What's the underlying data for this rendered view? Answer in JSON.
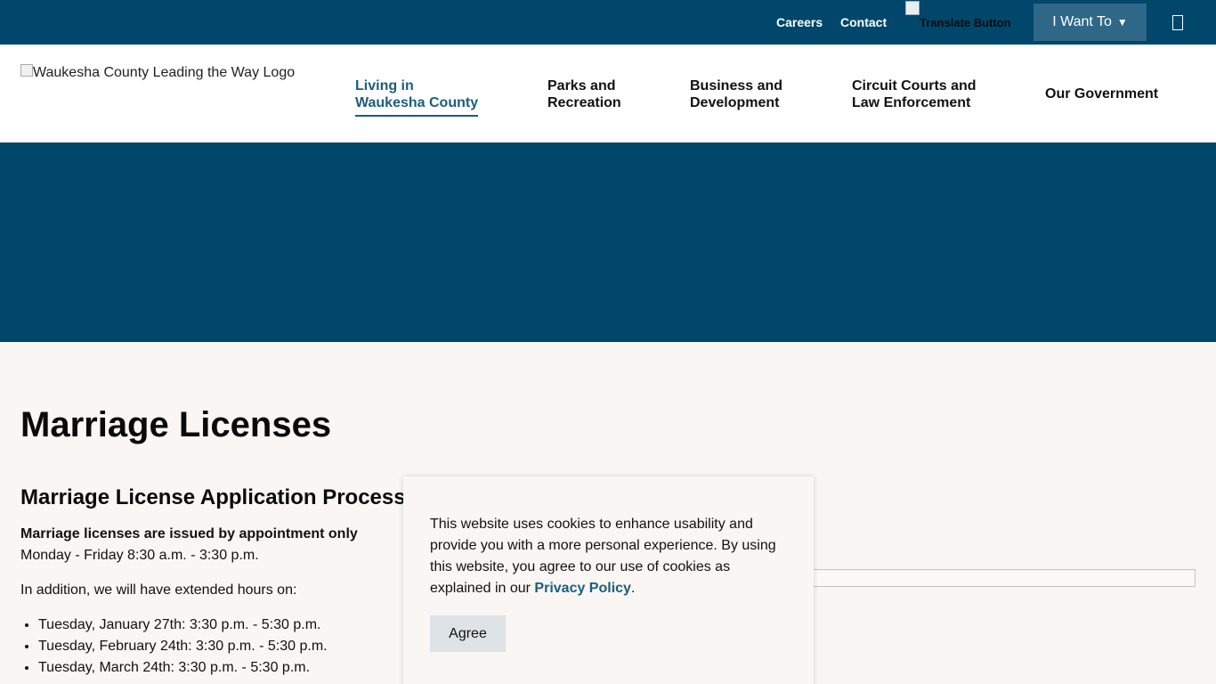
{
  "topbar": {
    "careers": "Careers",
    "contact": "Contact",
    "translate_alt": "Translate Button",
    "i_want_to": "I Want To",
    "caret": "▼",
    "search_icon": "search-icon"
  },
  "header": {
    "logo_alt": "Waukesha County Leading the Way Logo",
    "nav": [
      {
        "line1": "Living in",
        "line2": "Waukesha County",
        "active": true
      },
      {
        "line1": "Parks and",
        "line2": "Recreation"
      },
      {
        "line1": "Business and",
        "line2": "Development"
      },
      {
        "line1": "Circuit Courts and",
        "line2": "Law Enforcement"
      },
      {
        "line1": "Our Government",
        "line2": ""
      }
    ]
  },
  "main": {
    "title": "Marriage Licenses",
    "section_heading": "Marriage License Application Process",
    "intro_strong": "Marriage licenses are issued by appointment only",
    "intro_hours": "Monday - Friday 8:30 a.m. - 3:30 p.m.",
    "extended_intro": "In addition, we will have extended hours on:",
    "extended_hours": [
      "Tuesday, January 27th: 3:30 p.m. - 5:30 p.m.",
      "Tuesday, February 24th: 3:30 p.m. - 5:30 p.m.",
      "Tuesday, March 24th: 3:30 p.m. - 5:30 p.m."
    ]
  },
  "cookie": {
    "text": "This website uses cookies to enhance usability and provide you with a more personal experience. By using this website, you agree to our use of cookies as explained in our",
    "link": "Privacy Policy",
    "suffix": ".",
    "agree": "Agree"
  },
  "colors": {
    "brand_dark": "#00476b",
    "button_blue": "#2f6788",
    "link_blue": "#1a5e7e",
    "page_bg": "#f9f6f3"
  }
}
